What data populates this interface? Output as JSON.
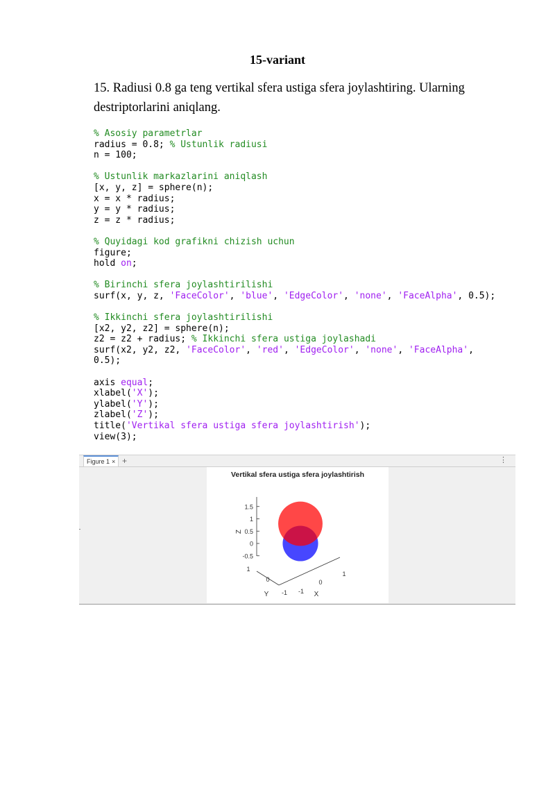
{
  "document": {
    "title": "15-variant",
    "task": "15. Radiusi 0.8 ga teng vertikal sfera ustiga sfera joylashtiring. Ularning destriptorlarini aniqlang."
  },
  "code_lines": [
    [
      {
        "t": "% Asosiy parametrlar",
        "c": "c"
      }
    ],
    [
      {
        "t": "radius = 0.8; ",
        "c": ""
      },
      {
        "t": "% Ustunlik radiusi",
        "c": "c"
      }
    ],
    [
      {
        "t": "n = 100;",
        "c": ""
      }
    ],
    [],
    [
      {
        "t": "% Ustunlik markazlarini aniqlash",
        "c": "c"
      }
    ],
    [
      {
        "t": "[x, y, z] = sphere(n);",
        "c": ""
      }
    ],
    [
      {
        "t": "x = x * radius;",
        "c": ""
      }
    ],
    [
      {
        "t": "y = y * radius;",
        "c": ""
      }
    ],
    [
      {
        "t": "z = z * radius;",
        "c": ""
      }
    ],
    [],
    [
      {
        "t": "% Quyidagi kod grafikni chizish uchun",
        "c": "c"
      }
    ],
    [
      {
        "t": "figure;",
        "c": ""
      }
    ],
    [
      {
        "t": "hold ",
        "c": ""
      },
      {
        "t": "on",
        "c": "k"
      },
      {
        "t": ";",
        "c": ""
      }
    ],
    [],
    [
      {
        "t": "% Birinchi sfera joylashtirilishi",
        "c": "c"
      }
    ],
    [
      {
        "t": "surf(x, y, z, ",
        "c": ""
      },
      {
        "t": "'FaceColor'",
        "c": "s"
      },
      {
        "t": ", ",
        "c": ""
      },
      {
        "t": "'blue'",
        "c": "s"
      },
      {
        "t": ", ",
        "c": ""
      },
      {
        "t": "'EdgeColor'",
        "c": "s"
      },
      {
        "t": ", ",
        "c": ""
      },
      {
        "t": "'none'",
        "c": "s"
      },
      {
        "t": ", ",
        "c": ""
      },
      {
        "t": "'FaceAlpha'",
        "c": "s"
      },
      {
        "t": ", 0.5);",
        "c": ""
      }
    ],
    [],
    [
      {
        "t": "% Ikkinchi sfera joylashtirilishi",
        "c": "c"
      }
    ],
    [
      {
        "t": "[x2, y2, z2] = sphere(n);",
        "c": ""
      }
    ],
    [
      {
        "t": "z2 = z2 + radius; ",
        "c": ""
      },
      {
        "t": "% Ikkinchi sfera ustiga joylashadi",
        "c": "c"
      }
    ],
    [
      {
        "t": "surf(x2, y2, z2, ",
        "c": ""
      },
      {
        "t": "'FaceColor'",
        "c": "s"
      },
      {
        "t": ", ",
        "c": ""
      },
      {
        "t": "'red'",
        "c": "s"
      },
      {
        "t": ", ",
        "c": ""
      },
      {
        "t": "'EdgeColor'",
        "c": "s"
      },
      {
        "t": ", ",
        "c": ""
      },
      {
        "t": "'none'",
        "c": "s"
      },
      {
        "t": ", ",
        "c": ""
      },
      {
        "t": "'FaceAlpha'",
        "c": "s"
      },
      {
        "t": ",",
        "c": ""
      }
    ],
    [
      {
        "t": "0.5);",
        "c": ""
      }
    ],
    [],
    [
      {
        "t": "axis ",
        "c": ""
      },
      {
        "t": "equal",
        "c": "k"
      },
      {
        "t": ";",
        "c": ""
      }
    ],
    [
      {
        "t": "xlabel(",
        "c": ""
      },
      {
        "t": "'X'",
        "c": "s"
      },
      {
        "t": ");",
        "c": ""
      }
    ],
    [
      {
        "t": "ylabel(",
        "c": ""
      },
      {
        "t": "'Y'",
        "c": "s"
      },
      {
        "t": ");",
        "c": ""
      }
    ],
    [
      {
        "t": "zlabel(",
        "c": ""
      },
      {
        "t": "'Z'",
        "c": "s"
      },
      {
        "t": ");",
        "c": ""
      }
    ],
    [
      {
        "t": "title(",
        "c": ""
      },
      {
        "t": "'Vertikal sfera ustiga sfera joylashtirish'",
        "c": "s"
      },
      {
        "t": ");",
        "c": ""
      }
    ],
    [
      {
        "t": "view(3);",
        "c": ""
      }
    ]
  ],
  "figure_window": {
    "tab_label": "Figure 1",
    "close_glyph": "×",
    "add_glyph": "+",
    "menu_glyph": "⋮"
  },
  "chart_data": {
    "type": "surface3d",
    "title": "Vertikal sfera ustiga sfera joylashtirish",
    "xlabel": "X",
    "ylabel": "Y",
    "zlabel": "Z",
    "z_ticks": [
      "1.5",
      "1",
      "0.5",
      "0",
      "-0.5"
    ],
    "x_ticks": [
      "-1",
      "0",
      "1"
    ],
    "y_ticks": [
      "-1",
      "0",
      "1"
    ],
    "spheres": [
      {
        "name": "",
        "center": [
          0,
          0,
          0
        ],
        "radius": 0.8,
        "color": "#0000ff",
        "alpha": 0.5
      },
      {
        "name": "",
        "center": [
          0,
          0,
          0.8
        ],
        "radius": 1,
        "color": "#ff0000",
        "alpha": 0.5
      }
    ]
  },
  "colors": {
    "comment": "#228b22",
    "string": "#a020f0",
    "tab_accent": "#5b8fd6"
  }
}
